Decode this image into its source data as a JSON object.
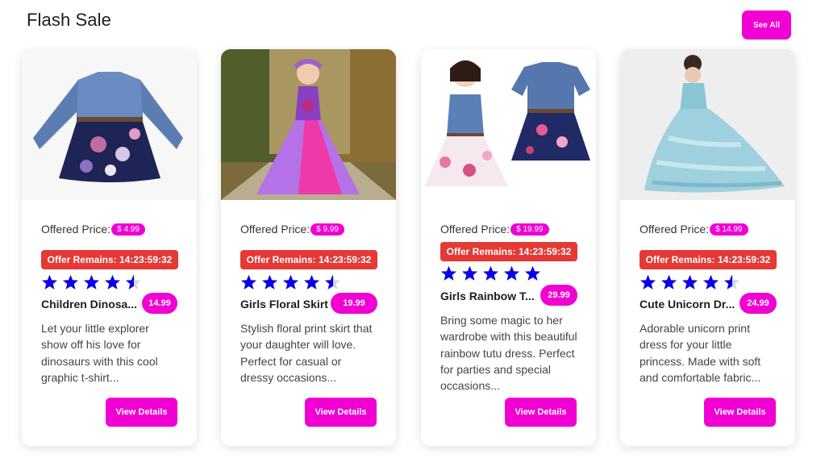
{
  "section": {
    "title": "Flash Sale",
    "see_all_label": "See All"
  },
  "colors": {
    "accent": "#f000d2",
    "offer": "#e53935",
    "star": "#0a00e6"
  },
  "labels": {
    "offered_price": "Offered Price:",
    "view_details": "View Details"
  },
  "products": [
    {
      "image_icon": "denim-floral-dress-image",
      "price": "$ 4.99",
      "offer": "Offer Remains: 14:23:59:32",
      "rating": 4.5,
      "name": "Children Dinosa...",
      "badge": "14.99",
      "description": "Let your little explorer show off his love for dinosaurs with this cool graphic t-shirt..."
    },
    {
      "image_icon": "purple-tutu-dress-image",
      "price": "$ 9.99",
      "offer": "Offer Remains: 14:23:59:32",
      "rating": 4.5,
      "name": "Girls Floral Skirt",
      "badge": "19.99",
      "description": "Stylish floral print skirt that your daughter will love. Perfect for casual or dressy occasions..."
    },
    {
      "image_icon": "denim-floral-dress-pair-image",
      "price": "$ 19.99",
      "offer": "Offer Remains: 14:23:59:32",
      "rating": 5,
      "name": "Girls Rainbow T...",
      "badge": "29.99",
      "description": "Bring some magic to her wardrobe with this beautiful rainbow tutu dress. Perfect for parties and special occasions..."
    },
    {
      "image_icon": "blue-ruffle-gown-image",
      "price": "$ 14.99",
      "offer": "Offer Remains: 14:23:59:32",
      "rating": 4.5,
      "name": "Cute Unicorn Dr...",
      "badge": "24.99",
      "description": "Adorable unicorn print dress for your little princess. Made with soft and comfortable fabric..."
    }
  ]
}
